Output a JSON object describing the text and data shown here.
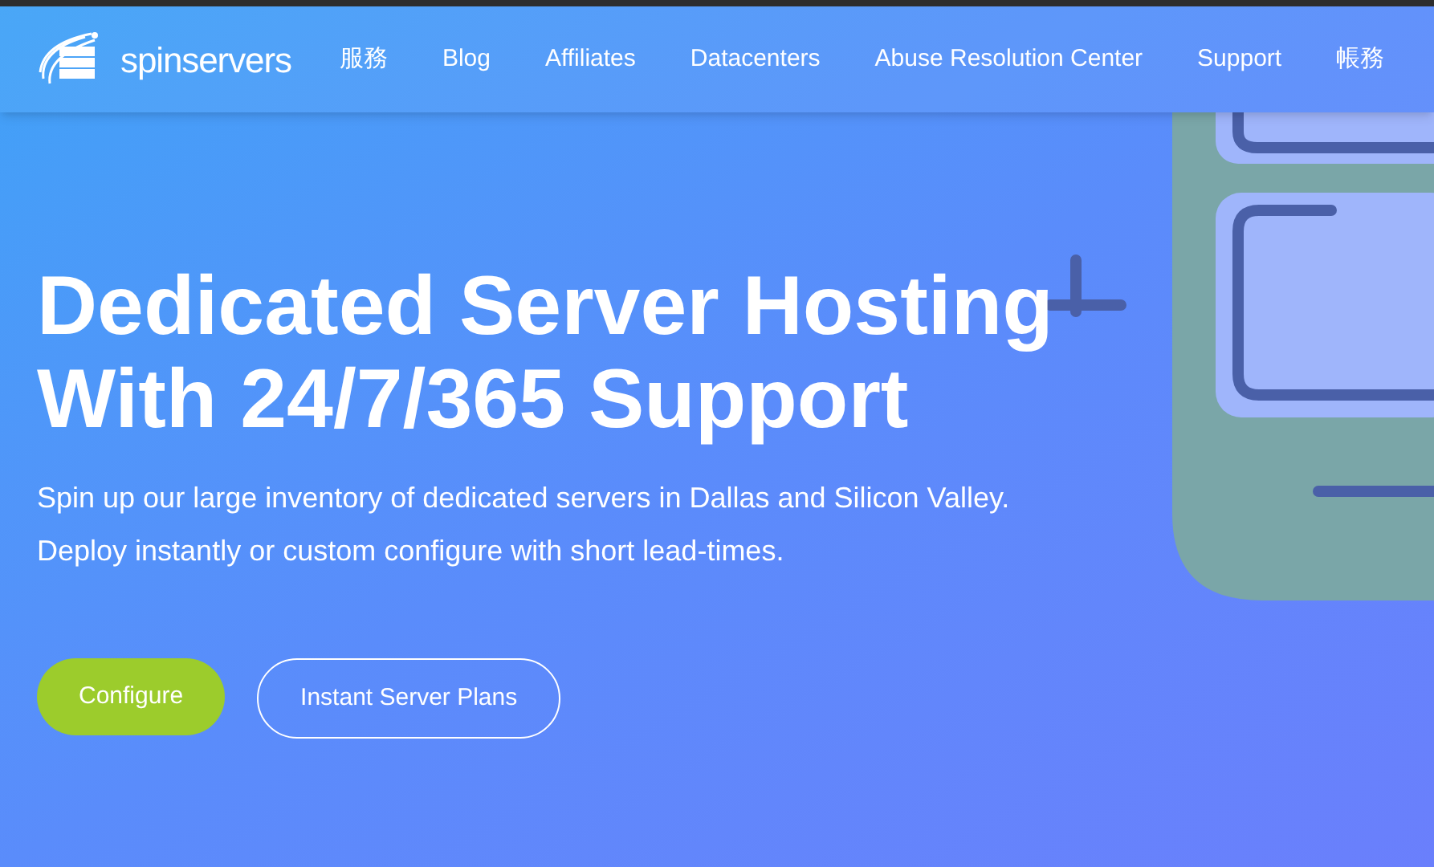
{
  "logo": {
    "text": "**spin**servers"
  },
  "nav": [
    {
      "label": "服務"
    },
    {
      "label": "Blog"
    },
    {
      "label": "Affiliates"
    },
    {
      "label": "Datacenters"
    },
    {
      "label": "Abuse Resolution Center"
    },
    {
      "label": "Support"
    },
    {
      "label": "帳務"
    }
  ],
  "hero": {
    "title": [
      "Dedicated Server Hosting",
      "With 24/7/365 Support"
    ],
    "description": [
      "Spin up our large inventory of dedicated servers in Dallas and Silicon Valley.",
      "Deploy instantly or custom configure with short lead-times."
    ],
    "buttons": [
      {
        "label": "Configure",
        "kind": "primary"
      },
      {
        "label": "Instant Server Plans",
        "kind": "outline"
      }
    ]
  }
}
